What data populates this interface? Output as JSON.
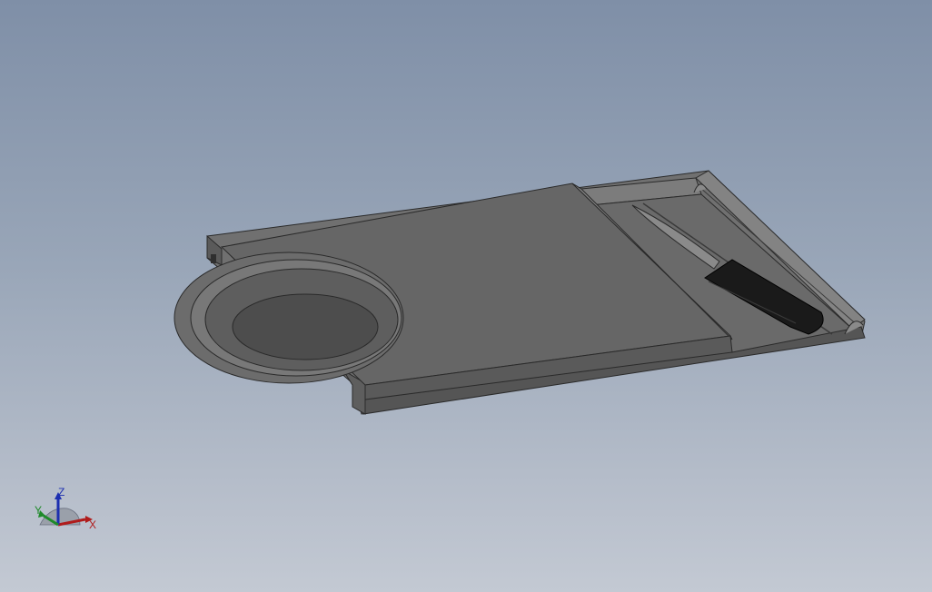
{
  "viewport": {
    "background_top": "#7f8fa7",
    "background_bottom": "#c3c9d3"
  },
  "model": {
    "parts": [
      "cutting-board-tray",
      "bowl",
      "sliding-board",
      "knife"
    ],
    "colors": {
      "body": "#6e6e6e",
      "body_light": "#7a7a7a",
      "edge": "#2a2a2a",
      "knife_handle": "#1a1a1a"
    }
  },
  "triad": {
    "x_label": "X",
    "y_label": "Y",
    "z_label": "Z",
    "x_color": "#b01c1c",
    "y_color": "#1f8a2a",
    "z_color": "#1c2fb0"
  }
}
